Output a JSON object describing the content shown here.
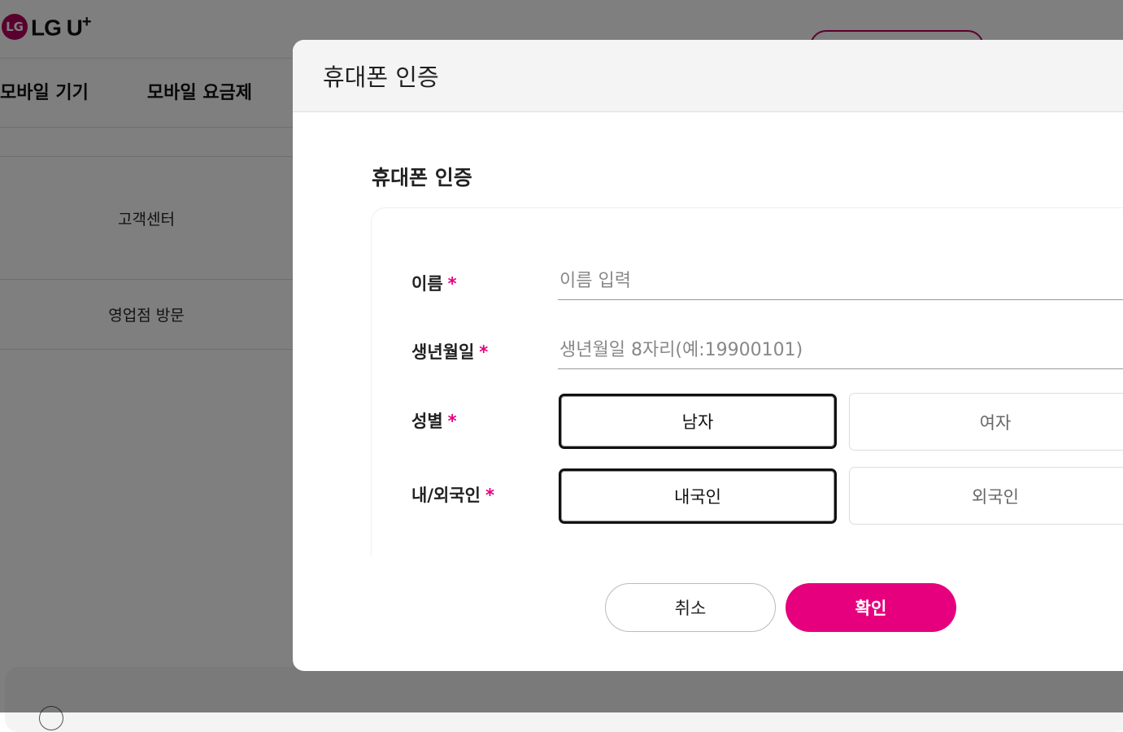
{
  "background": {
    "logo": {
      "mark": "LG",
      "text": "LG U",
      "sup": "+"
    },
    "nav": [
      "모바일 기기",
      "모바일 요금제"
    ],
    "side_menu": [
      "고객센터",
      "영업점 방문"
    ]
  },
  "modal": {
    "title": "휴대폰 인증",
    "section_title": "휴대폰 인증",
    "required_mark": "*",
    "fields": {
      "name": {
        "label": "이름",
        "placeholder": "이름 입력",
        "value": ""
      },
      "birth": {
        "label": "생년월일",
        "placeholder": "생년월일 8자리(예:19900101)",
        "value": ""
      },
      "gender": {
        "label": "성별",
        "options": [
          "남자",
          "여자"
        ],
        "selected": "남자"
      },
      "nationality": {
        "label": "내/외국인",
        "options": [
          "내국인",
          "외국인"
        ],
        "selected": "내국인"
      }
    },
    "buttons": {
      "cancel": "취소",
      "ok": "확인"
    }
  },
  "colors": {
    "accent": "#e6007e",
    "brand": "#b5005c",
    "overlay": "rgba(0,0,0,0.5)"
  }
}
